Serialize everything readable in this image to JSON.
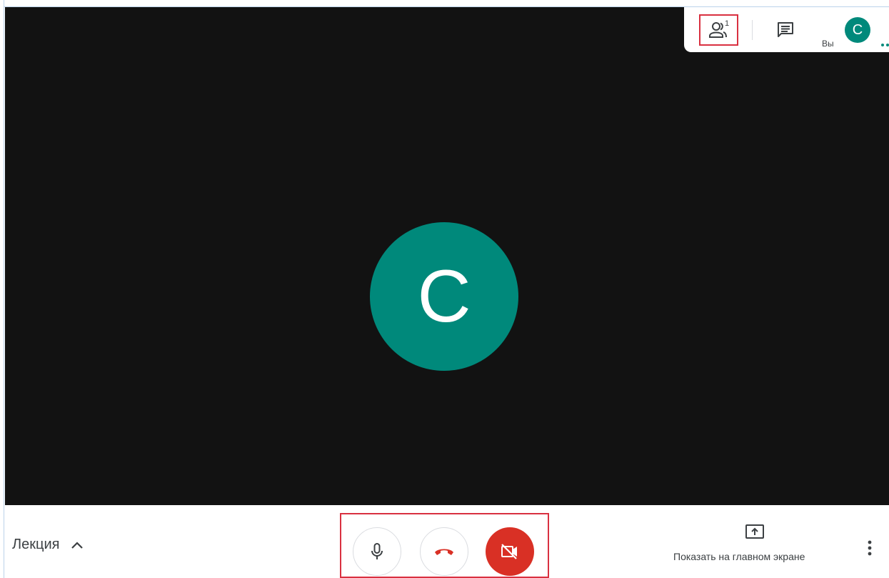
{
  "stage": {
    "participant_initial": "C"
  },
  "top_panel": {
    "people_count": "1",
    "you_label": "Вы",
    "self_initial": "C"
  },
  "bottom_bar": {
    "meeting_name": "Лекция",
    "present_label": "Показать на главном экране"
  },
  "icons": {
    "people": "people-icon",
    "chat": "chat-icon",
    "caret": "chevron-up-icon",
    "mic": "microphone-icon",
    "hangup": "phone-hangup-icon",
    "camera_off": "camera-off-icon",
    "present": "present-screen-icon",
    "more": "more-vertical-icon"
  },
  "colors": {
    "stage_bg": "#121212",
    "avatar": "#00897b",
    "highlight_box": "#d93040",
    "hangup": "#d93025",
    "camera_off_bg": "#d93025",
    "text": "#3c4043"
  }
}
